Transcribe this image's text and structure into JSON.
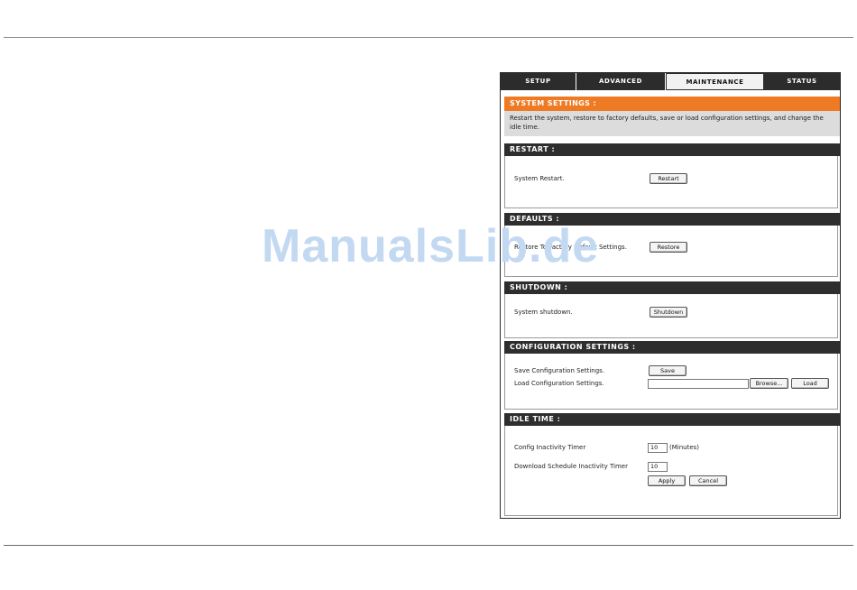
{
  "tabs": [
    {
      "label": "SETUP",
      "active": false
    },
    {
      "label": "ADVANCED",
      "active": false
    },
    {
      "label": "MAINTENANCE",
      "active": true
    },
    {
      "label": "STATUS",
      "active": false
    }
  ],
  "system_settings": {
    "title": "SYSTEM SETTINGS :",
    "description": "Restart the system, restore to factory defaults, save or load configuration settings, and change the idle time."
  },
  "restart": {
    "title": "RESTART :",
    "label": "System Restart.",
    "button": "Restart"
  },
  "defaults": {
    "title": "DEFAULTS :",
    "label": "Restore To Factory Default Settings.",
    "button": "Restore"
  },
  "shutdown": {
    "title": "SHUTDOWN :",
    "label": "System shutdown.",
    "button": "Shutdown"
  },
  "configuration": {
    "title": "CONFIGURATION SETTINGS :",
    "save_label": "Save Configuration Settings.",
    "save_button": "Save",
    "load_label": "Load Configuration Settings.",
    "file_value": "",
    "browse_button": "Browse...",
    "load_button": "Load"
  },
  "idle_time": {
    "title": "IDLE TIME :",
    "config_label": "Config Inactivity Timer",
    "config_value": "10",
    "config_unit": "(Minutes)",
    "download_label": "Download Schedule Inactivity Timer",
    "download_value": "10",
    "apply_button": "Apply",
    "cancel_button": "Cancel"
  },
  "watermark": "ManualsLib.de",
  "colors": {
    "accent_orange": "#ef7a24",
    "header_dark": "#2e2e2e",
    "intro_gray": "#dcdcdc"
  }
}
